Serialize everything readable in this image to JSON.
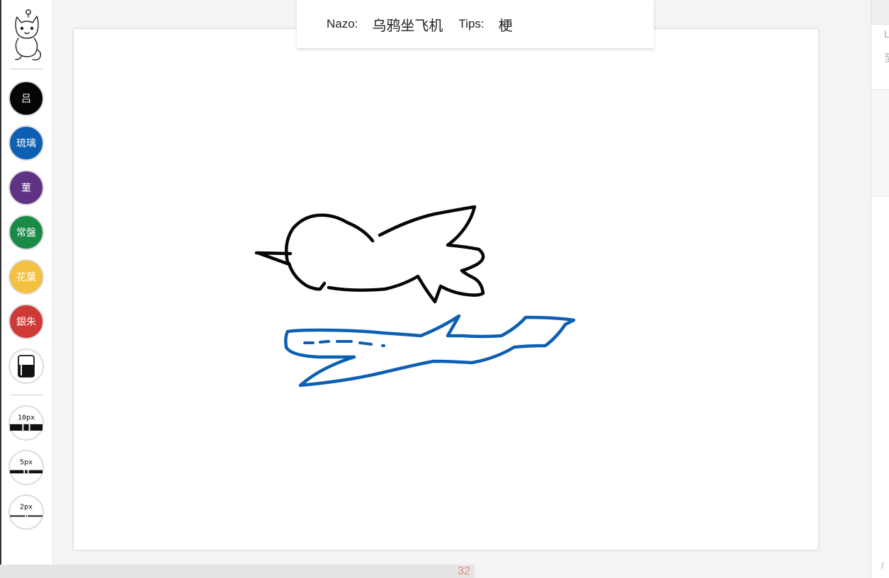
{
  "prompt": {
    "nazo_label": "Nazo:",
    "nazo_value": "乌鸦坐飞机",
    "tips_label": "Tips:",
    "tips_value": "梗"
  },
  "colors": [
    {
      "label": "吕",
      "hex": "#050505"
    },
    {
      "label": "琉璃",
      "hex": "#0c5fb3"
    },
    {
      "label": "菫",
      "hex": "#5f3384"
    },
    {
      "label": "常盤",
      "hex": "#1a8a47"
    },
    {
      "label": "花葉",
      "hex": "#f4c03f"
    },
    {
      "label": "銀朱",
      "hex": "#cf3a36"
    }
  ],
  "eraser": {
    "icon": "eraser-icon"
  },
  "brush_sizes": [
    "10px",
    "5px",
    "2px"
  ],
  "counter": "32",
  "right_panel": {
    "fragments": [
      "L",
      "至",
      "/"
    ]
  }
}
